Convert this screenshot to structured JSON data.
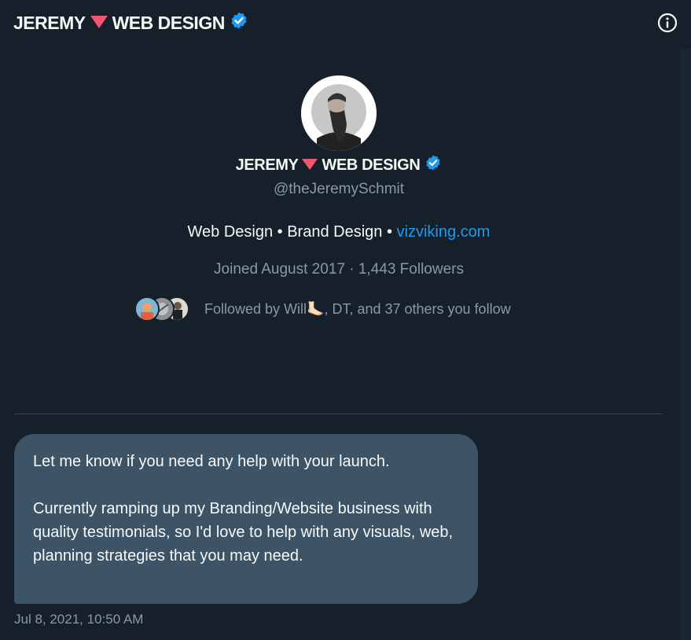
{
  "header": {
    "name_part1": "JEREMY",
    "name_part2": "WEB DESIGN",
    "info_icon": "info-circle-icon"
  },
  "profile": {
    "name_part1": "JEREMY",
    "name_part2": "WEB DESIGN",
    "handle": "@theJeremySchmit",
    "bio_text": "Web Design • Brand Design • ",
    "bio_link": "vizviking.com",
    "joined": "Joined August 2017",
    "separator": " · ",
    "followers": "1,443 Followers",
    "followed_by": "Followed by Will🦶🏻, DT, and 37 others you follow"
  },
  "message": {
    "paragraph1": "Let me know if you need any help with your launch.",
    "paragraph2": "Currently ramping up my Branding/Website business with quality testimonials, so I'd love to help with any visuals, web, planning strategies that you may need.",
    "timestamp": "Jul 8, 2021, 10:50 AM"
  },
  "colors": {
    "background": "#15202b",
    "bubble": "#3d5466",
    "accent": "#1d9bf0",
    "triangle": "#f4546e",
    "muted": "#8b98a5"
  }
}
